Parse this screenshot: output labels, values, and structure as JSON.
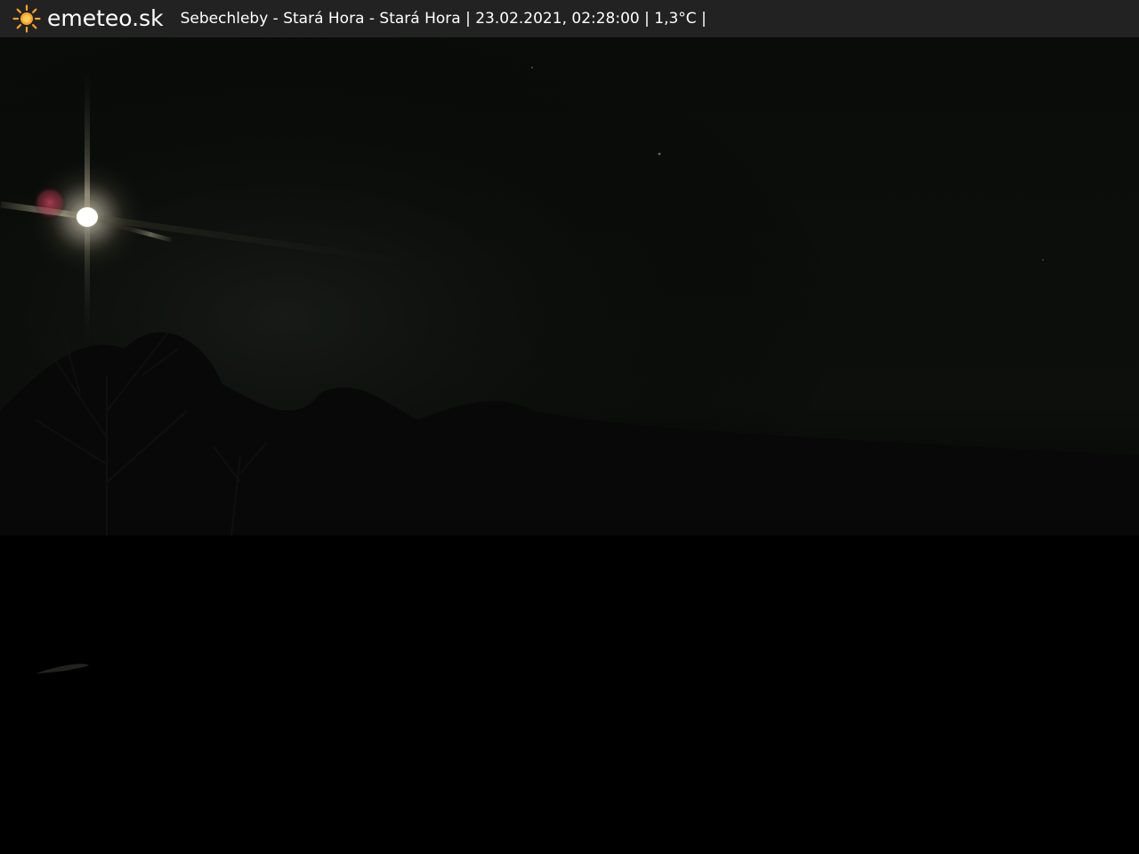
{
  "header": {
    "brand": "emeteo.sk",
    "caption": "Sebechleby - Stará Hora - Stará Hora | 23.02.2021, 02:28:00 | 1,3°C |",
    "logo_icon": "sun-icon",
    "colors": {
      "bar": "#222222",
      "text": "#ffffff",
      "sun": "#f5a623"
    }
  },
  "scene": {
    "subject": "night webcam view",
    "colors": {
      "sky": "#0b0d0b",
      "ground": "#000000"
    }
  }
}
